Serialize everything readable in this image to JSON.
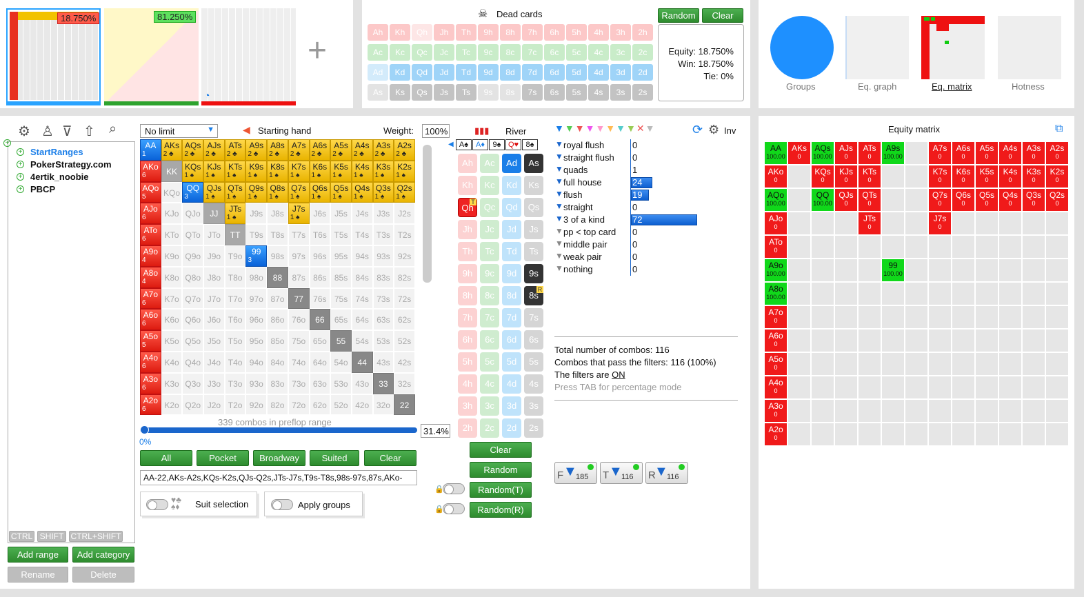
{
  "top": {
    "range_tabs": [
      {
        "pct": "18.750%"
      },
      {
        "pct": "81.250%"
      },
      {
        "pct": ""
      }
    ],
    "add_tab": "+"
  },
  "dead": {
    "title": "Dead cards",
    "random": "Random",
    "clear": "Clear",
    "equity": "Equity: 18.750%",
    "win": "Win: 18.750%",
    "tie": "Tie: 0%",
    "rows": [
      [
        "Ah",
        "Kh",
        "Qh",
        "Jh",
        "Th",
        "9h",
        "8h",
        "7h",
        "6h",
        "5h",
        "4h",
        "3h",
        "2h"
      ],
      [
        "Ac",
        "Kc",
        "Qc",
        "Jc",
        "Tc",
        "9c",
        "8c",
        "7c",
        "6c",
        "5c",
        "4c",
        "3c",
        "2c"
      ],
      [
        "Ad",
        "Kd",
        "Qd",
        "Jd",
        "Td",
        "9d",
        "8d",
        "7d",
        "6d",
        "5d",
        "4d",
        "3d",
        "2d"
      ],
      [
        "As",
        "Ks",
        "Qs",
        "Js",
        "Ts",
        "9s",
        "8s",
        "7s",
        "6s",
        "5s",
        "4s",
        "3s",
        "2s"
      ]
    ]
  },
  "views": [
    {
      "label": "Groups"
    },
    {
      "label": "Eq. graph"
    },
    {
      "label": "Eq. matrix"
    },
    {
      "label": "Hotness"
    }
  ],
  "tree": {
    "items": [
      "StartRanges",
      "PokerStrategy.com",
      "4ertik_noobie",
      "PBCP"
    ],
    "mods": [
      "CTRL",
      "SHIFT",
      "CTRL+SHIFT"
    ],
    "add_range": "Add range",
    "add_category": "Add category",
    "rename": "Rename",
    "delete": "Delete"
  },
  "preflop": {
    "limit": "No limit",
    "starting_hand": "Starting hand",
    "weight_label": "Weight:",
    "weight": "100%",
    "combos_label": "339 combos in preflop range",
    "pct": "31.4%",
    "slider_min": "0%",
    "buttons": [
      "All",
      "Pocket",
      "Broadway",
      "Suited",
      "Clear"
    ],
    "range_text": "AA-22,AKs-A2s,KQs-K2s,QJs-Q2s,JTs-J7s,T9s-T8s,98s-97s,87s,AKo-",
    "suit_selection": "Suit selection",
    "apply_groups": "Apply groups"
  },
  "board": {
    "street": "River",
    "cards": [
      "A♠",
      "A♦",
      "9♠",
      "Q♥",
      "8♠"
    ],
    "clear": "Clear",
    "random": "Random",
    "random_t": "Random(T)",
    "random_r": "Random(R)",
    "cols": [
      [
        "Ah",
        "Kh",
        "Qh",
        "Jh",
        "Th",
        "9h",
        "8h",
        "7h",
        "6h",
        "5h",
        "4h",
        "3h",
        "2h"
      ],
      [
        "Ac",
        "Kc",
        "Qc",
        "Jc",
        "Tc",
        "9c",
        "8c",
        "7c",
        "6c",
        "5c",
        "4c",
        "3c",
        "2c"
      ],
      [
        "Ad",
        "Kd",
        "Qd",
        "Jd",
        "Td",
        "9d",
        "8d",
        "7d",
        "6d",
        "5d",
        "4d",
        "3d",
        "2d"
      ],
      [
        "As",
        "Ks",
        "Qs",
        "Js",
        "Ts",
        "9s",
        "8s",
        "7s",
        "6s",
        "5s",
        "4s",
        "3s",
        "2s"
      ]
    ]
  },
  "stats": {
    "inv": "Inv",
    "rows": [
      {
        "label": "royal flush",
        "value": "0"
      },
      {
        "label": "straight flush",
        "value": "0"
      },
      {
        "label": "quads",
        "value": "1"
      },
      {
        "label": "full house",
        "value": "24"
      },
      {
        "label": "flush",
        "value": "19"
      },
      {
        "label": "straight",
        "value": "0"
      },
      {
        "label": "3 of a kind",
        "value": "72"
      },
      {
        "label": "pp < top card",
        "value": "0"
      },
      {
        "label": "middle pair",
        "value": "0"
      },
      {
        "label": "weak pair",
        "value": "0"
      },
      {
        "label": "nothing",
        "value": "0"
      }
    ],
    "total": "Total number of combos: 116",
    "pass": "Combos that pass the filters: 116 (100%)",
    "filters_on_pre": "The filters are ",
    "filters_on": "ON",
    "tab_hint": "Press TAB for percentage mode",
    "filter_buttons": [
      {
        "letter": "F",
        "count": "185"
      },
      {
        "letter": "T",
        "count": "116"
      },
      {
        "letter": "R",
        "count": "116"
      }
    ]
  },
  "equity_matrix": {
    "title": "Equity matrix"
  }
}
